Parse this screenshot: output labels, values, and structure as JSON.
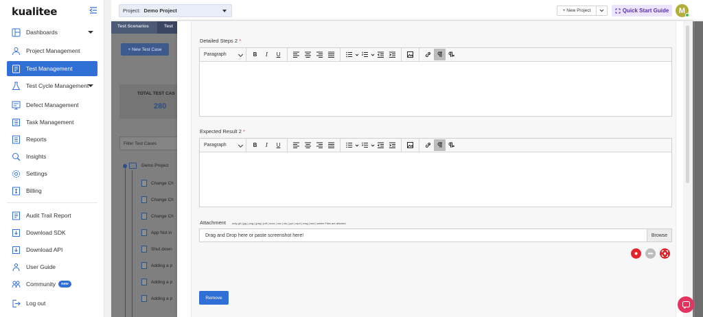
{
  "sidebar": {
    "logo": "kualitee",
    "items": [
      {
        "label": "Dashboards",
        "icon": "dashboard-icon"
      },
      {
        "label": "Project Management",
        "icon": "project-management-icon"
      },
      {
        "label": "Test Management",
        "icon": "test-management-icon",
        "active": true
      },
      {
        "label": "Test Cycle Management",
        "icon": "test-cycle-icon"
      },
      {
        "label": "Defect Management",
        "icon": "defect-icon"
      },
      {
        "label": "Task Management",
        "icon": "task-icon"
      },
      {
        "label": "Reports",
        "icon": "reports-icon"
      },
      {
        "label": "Insights",
        "icon": "insights-icon"
      },
      {
        "label": "Settings",
        "icon": "gear-icon"
      },
      {
        "label": "Billing",
        "icon": "billing-icon"
      },
      {
        "label": "Audit Trail Report",
        "icon": "audit-icon"
      },
      {
        "label": "Download SDK",
        "icon": "download-sdk-icon"
      },
      {
        "label": "Download API",
        "icon": "download-api-icon"
      },
      {
        "label": "User Guide",
        "icon": "user-guide-icon"
      },
      {
        "label": "Community",
        "icon": "community-icon",
        "badge": "new"
      },
      {
        "label": "Log out",
        "icon": "logout-icon"
      }
    ]
  },
  "header": {
    "project_label": "Project:",
    "project_value": "Demo Project",
    "new_project": "+ New Project",
    "quick_start": "Quick Start Guide",
    "avatar_initial": "M"
  },
  "background": {
    "tab_scenarios": "Test Scenarios",
    "tab_cases": "Test",
    "new_case_button": "+ New Test Case",
    "total_label": "TOTAL TEST CAS",
    "total_value": "280",
    "filter_placeholder": "Filter Test Cases",
    "root_node": "Demo Project",
    "nodes": [
      "Change Ch",
      "Change Ch",
      "Change Ch",
      "App Not in",
      "Shut down",
      "Adding a p",
      "Adding a p",
      "Adding a p"
    ]
  },
  "modal": {
    "steps_label": "Detailed Steps 2",
    "result_label": "Expected Result 2",
    "required_mark": "*",
    "paragraph": "Paragraph",
    "attachment_label": "Attachment",
    "attachment_hint": "only gif | jpg | png | jpeg | pdf | docx | csv | xls | ppt | mp4 | msg | eml | webm Files are allowed.",
    "dropzone_text": "Drag and Drop here or paste screenshot here!",
    "browse_label": "Browse",
    "remove_label": "Remove"
  },
  "colors": {
    "primary": "#2f6fd6",
    "quick_start_bg": "#ece4fb",
    "quick_start_text": "#5b2fb0",
    "record_red": "#e3242b",
    "chat_pink": "#e5335f"
  }
}
